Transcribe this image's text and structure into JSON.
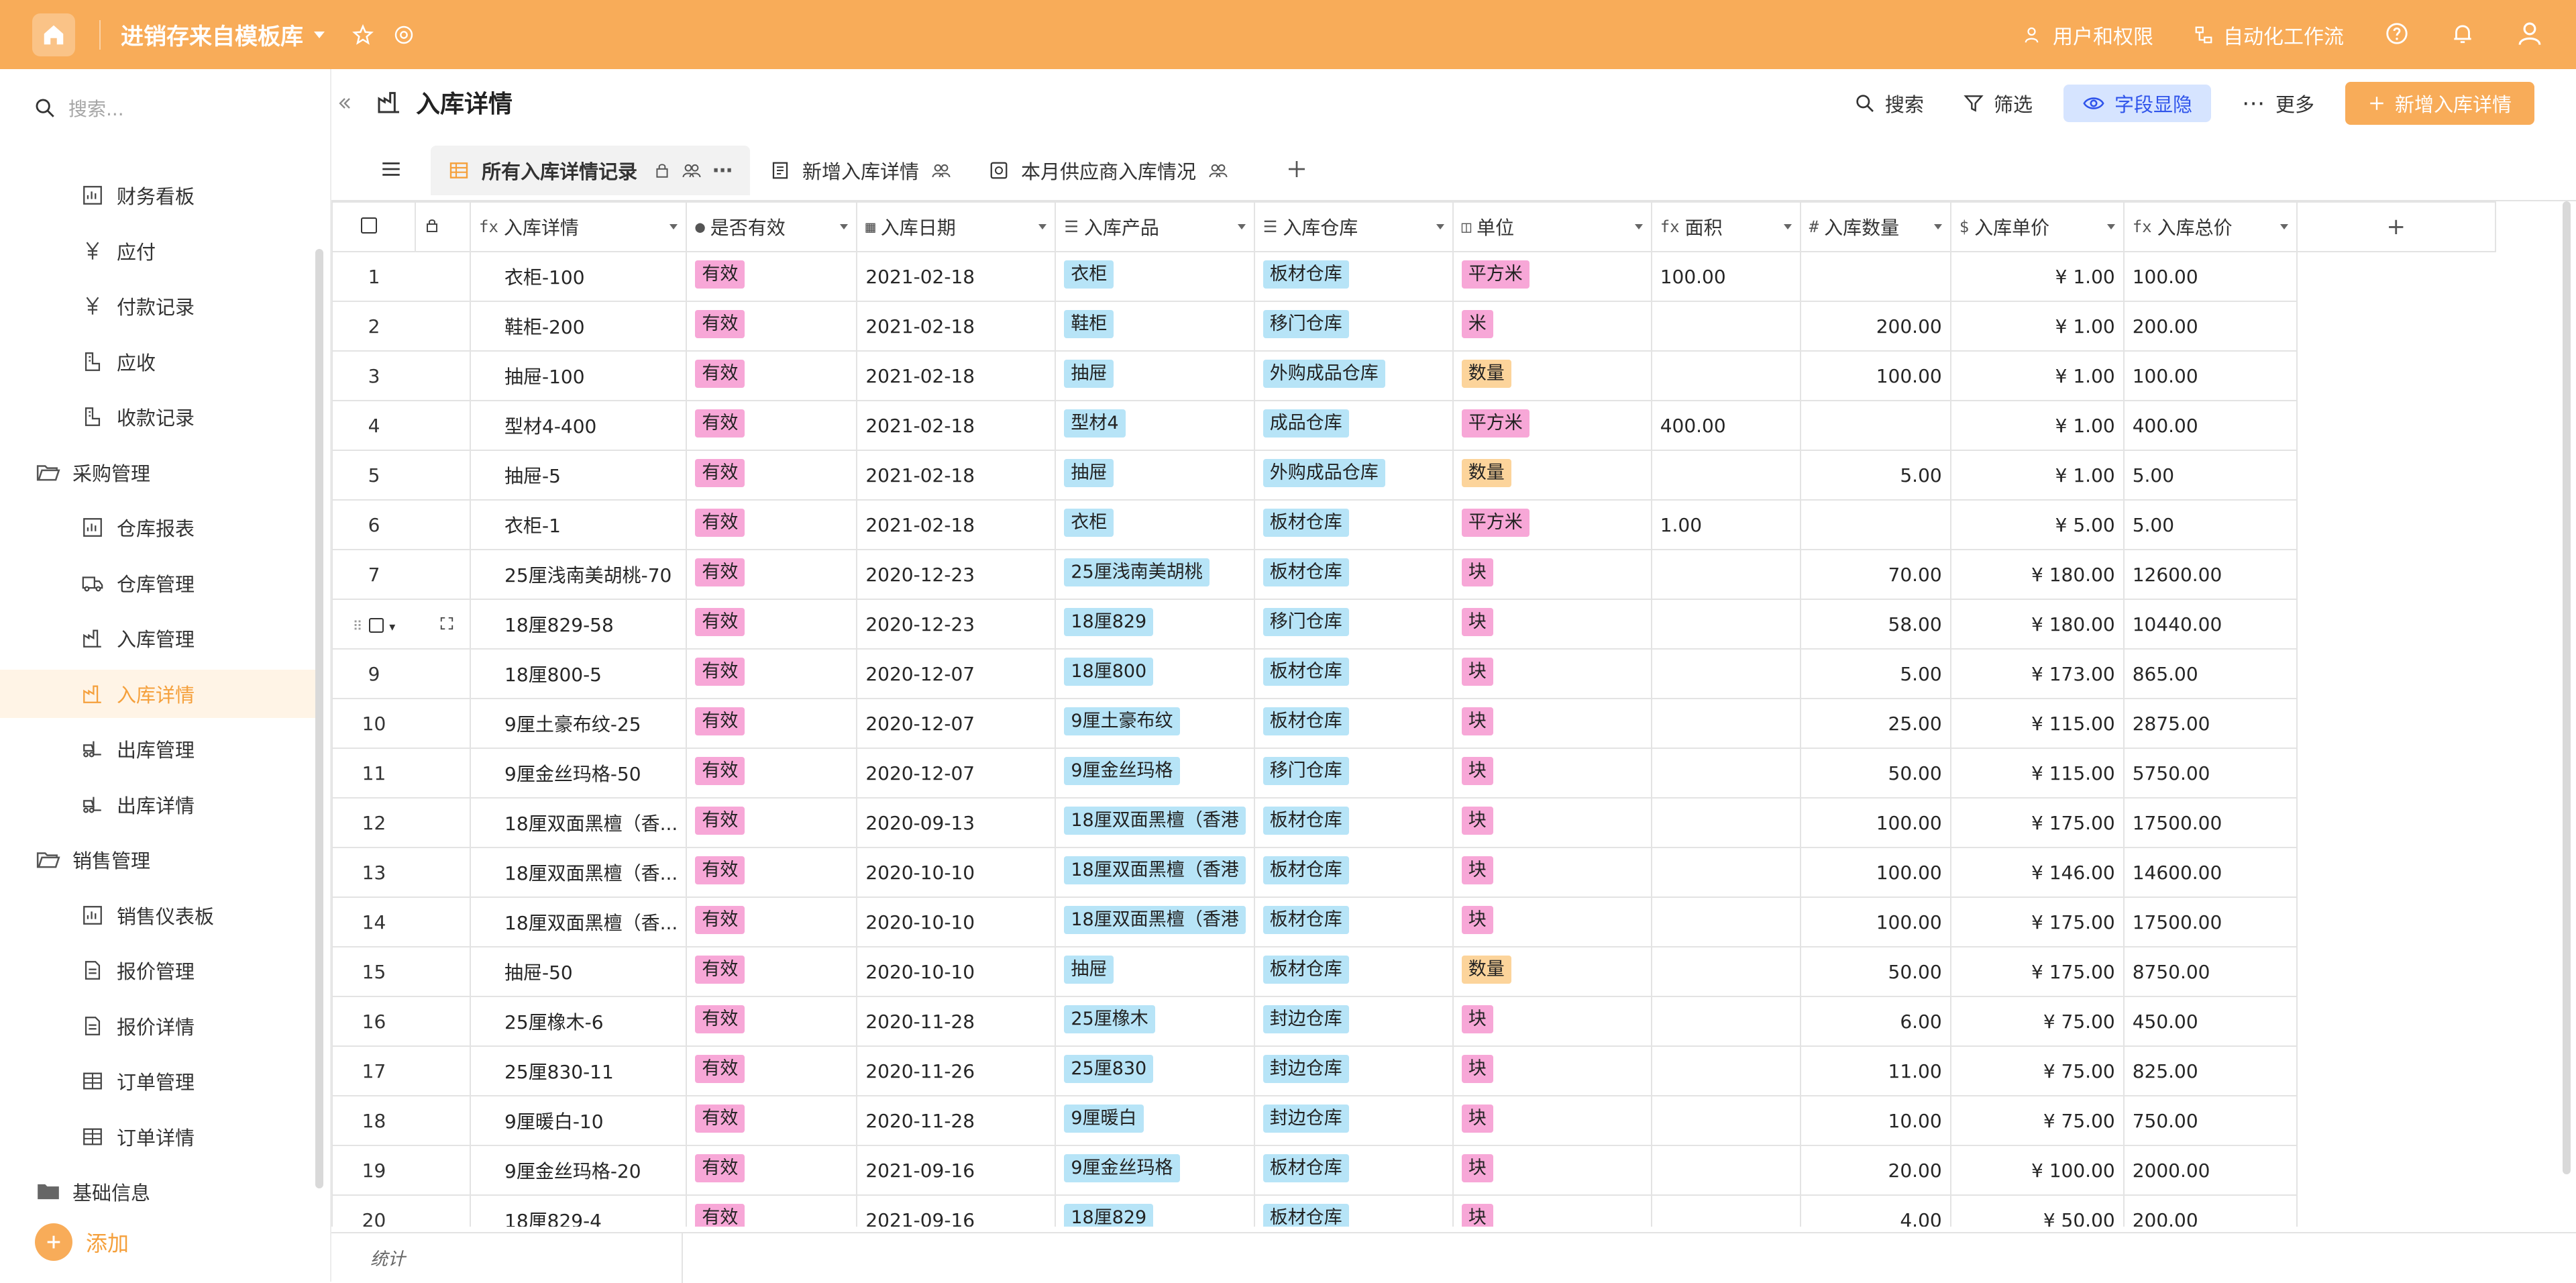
{
  "topbar": {
    "app_title": "进销存来自模板库",
    "users_label": "用户和权限",
    "automation_label": "自动化工作流"
  },
  "sidebar": {
    "search_placeholder": "搜索...",
    "items": [
      {
        "label": "财务看板",
        "level": "child",
        "icon": "dashboard-icon"
      },
      {
        "label": "应付",
        "level": "child",
        "icon": "yen-icon"
      },
      {
        "label": "付款记录",
        "level": "child",
        "icon": "yen-icon"
      },
      {
        "label": "应收",
        "level": "child",
        "icon": "receipt-icon"
      },
      {
        "label": "收款记录",
        "level": "child",
        "icon": "receipt-icon"
      },
      {
        "label": "采购管理",
        "level": "group",
        "icon": "folder-open-icon"
      },
      {
        "label": "仓库报表",
        "level": "child",
        "icon": "dashboard-icon"
      },
      {
        "label": "仓库管理",
        "level": "child",
        "icon": "truck-icon"
      },
      {
        "label": "入库管理",
        "level": "child",
        "icon": "factory-icon"
      },
      {
        "label": "入库详情",
        "level": "child",
        "icon": "factory-icon",
        "active": true
      },
      {
        "label": "出库管理",
        "level": "child",
        "icon": "forklift-icon"
      },
      {
        "label": "出库详情",
        "level": "child",
        "icon": "forklift-icon"
      },
      {
        "label": "销售管理",
        "level": "group",
        "icon": "folder-open-icon"
      },
      {
        "label": "销售仪表板",
        "level": "child",
        "icon": "dashboard-icon"
      },
      {
        "label": "报价管理",
        "level": "child",
        "icon": "document-icon"
      },
      {
        "label": "报价详情",
        "level": "child",
        "icon": "document-icon"
      },
      {
        "label": "订单管理",
        "level": "child",
        "icon": "grid-icon"
      },
      {
        "label": "订单详情",
        "level": "child",
        "icon": "grid-icon"
      },
      {
        "label": "基础信息",
        "level": "group",
        "icon": "folder-icon"
      }
    ],
    "add_label": "添加"
  },
  "header": {
    "title": "入库详情",
    "search_label": "搜索",
    "filter_label": "筛选",
    "fields_label": "字段显隐",
    "more_label": "更多",
    "new_label": "新增入库详情"
  },
  "views": {
    "tabs": [
      {
        "label": "所有入库详情记录",
        "active": true,
        "icon": "grid-view-icon"
      },
      {
        "label": "新增入库详情",
        "active": false,
        "icon": "form-view-icon"
      },
      {
        "label": "本月供应商入库情况",
        "active": false,
        "icon": "dashboard-view-icon"
      }
    ]
  },
  "table": {
    "columns": [
      {
        "label": "入库详情",
        "icon": "fx"
      },
      {
        "label": "是否有效",
        "icon": "●"
      },
      {
        "label": "入库日期",
        "icon": "▦"
      },
      {
        "label": "入库产品",
        "icon": "☰"
      },
      {
        "label": "入库仓库",
        "icon": "☰"
      },
      {
        "label": "单位",
        "icon": "◫"
      },
      {
        "label": "面积",
        "icon": "fx"
      },
      {
        "label": "入库数量",
        "icon": "#"
      },
      {
        "label": "入库单价",
        "icon": "$"
      },
      {
        "label": "入库总价",
        "icon": "fx"
      }
    ],
    "rows": [
      {
        "n": "1",
        "name": "衣柜-100",
        "valid": "有效",
        "date": "2021-02-18",
        "product": "衣柜",
        "warehouse": "板材仓库",
        "unit": "平方米",
        "unit_color": "pink",
        "area": "100.00",
        "qty": "",
        "price": "¥ 1.00",
        "total": "100.00"
      },
      {
        "n": "2",
        "name": "鞋柜-200",
        "valid": "有效",
        "date": "2021-02-18",
        "product": "鞋柜",
        "warehouse": "移门仓库",
        "unit": "米",
        "unit_color": "pink",
        "area": "",
        "qty": "200.00",
        "price": "¥ 1.00",
        "total": "200.00"
      },
      {
        "n": "3",
        "name": "抽屉-100",
        "valid": "有效",
        "date": "2021-02-18",
        "product": "抽屉",
        "warehouse": "外购成品仓库",
        "unit": "数量",
        "unit_color": "orange",
        "area": "",
        "qty": "100.00",
        "price": "¥ 1.00",
        "total": "100.00"
      },
      {
        "n": "4",
        "name": "型材4-400",
        "valid": "有效",
        "date": "2021-02-18",
        "product": "型材4",
        "warehouse": "成品仓库",
        "unit": "平方米",
        "unit_color": "pink",
        "area": "400.00",
        "qty": "",
        "price": "¥ 1.00",
        "total": "400.00"
      },
      {
        "n": "5",
        "name": "抽屉-5",
        "valid": "有效",
        "date": "2021-02-18",
        "product": "抽屉",
        "warehouse": "外购成品仓库",
        "unit": "数量",
        "unit_color": "orange",
        "area": "",
        "qty": "5.00",
        "price": "¥ 1.00",
        "total": "5.00"
      },
      {
        "n": "6",
        "name": "衣柜-1",
        "valid": "有效",
        "date": "2021-02-18",
        "product": "衣柜",
        "warehouse": "板材仓库",
        "unit": "平方米",
        "unit_color": "pink",
        "area": "1.00",
        "qty": "",
        "price": "¥ 5.00",
        "total": "5.00"
      },
      {
        "n": "7",
        "name": "25厘浅南美胡桃-70",
        "valid": "有效",
        "date": "2020-12-23",
        "product": "25厘浅南美胡桃",
        "warehouse": "板材仓库",
        "unit": "块",
        "unit_color": "pink",
        "area": "",
        "qty": "70.00",
        "price": "¥ 180.00",
        "total": "12600.00"
      },
      {
        "n": "",
        "name": "18厘829-58",
        "valid": "有效",
        "date": "2020-12-23",
        "product": "18厘829",
        "warehouse": "移门仓库",
        "unit": "块",
        "unit_color": "pink",
        "area": "",
        "qty": "58.00",
        "price": "¥ 180.00",
        "total": "10440.00",
        "hover": true
      },
      {
        "n": "9",
        "name": "18厘800-5",
        "valid": "有效",
        "date": "2020-12-07",
        "product": "18厘800",
        "warehouse": "板材仓库",
        "unit": "块",
        "unit_color": "pink",
        "area": "",
        "qty": "5.00",
        "price": "¥ 173.00",
        "total": "865.00"
      },
      {
        "n": "10",
        "name": "9厘土豪布纹-25",
        "valid": "有效",
        "date": "2020-12-07",
        "product": "9厘土豪布纹",
        "warehouse": "板材仓库",
        "unit": "块",
        "unit_color": "pink",
        "area": "",
        "qty": "25.00",
        "price": "¥ 115.00",
        "total": "2875.00"
      },
      {
        "n": "11",
        "name": "9厘金丝玛格-50",
        "valid": "有效",
        "date": "2020-12-07",
        "product": "9厘金丝玛格",
        "warehouse": "移门仓库",
        "unit": "块",
        "unit_color": "pink",
        "area": "",
        "qty": "50.00",
        "price": "¥ 115.00",
        "total": "5750.00"
      },
      {
        "n": "12",
        "name": "18厘双面黑檀（香...",
        "valid": "有效",
        "date": "2020-09-13",
        "product": "18厘双面黑檀（香港",
        "warehouse": "板材仓库",
        "unit": "块",
        "unit_color": "pink",
        "area": "",
        "qty": "100.00",
        "price": "¥ 175.00",
        "total": "17500.00"
      },
      {
        "n": "13",
        "name": "18厘双面黑檀（香...",
        "valid": "有效",
        "date": "2020-10-10",
        "product": "18厘双面黑檀（香港",
        "warehouse": "板材仓库",
        "unit": "块",
        "unit_color": "pink",
        "area": "",
        "qty": "100.00",
        "price": "¥ 146.00",
        "total": "14600.00"
      },
      {
        "n": "14",
        "name": "18厘双面黑檀（香...",
        "valid": "有效",
        "date": "2020-10-10",
        "product": "18厘双面黑檀（香港",
        "warehouse": "板材仓库",
        "unit": "块",
        "unit_color": "pink",
        "area": "",
        "qty": "100.00",
        "price": "¥ 175.00",
        "total": "17500.00"
      },
      {
        "n": "15",
        "name": "抽屉-50",
        "valid": "有效",
        "date": "2020-10-10",
        "product": "抽屉",
        "warehouse": "板材仓库",
        "unit": "数量",
        "unit_color": "orange",
        "area": "",
        "qty": "50.00",
        "price": "¥ 175.00",
        "total": "8750.00"
      },
      {
        "n": "16",
        "name": "25厘橡木-6",
        "valid": "有效",
        "date": "2020-11-28",
        "product": "25厘橡木",
        "warehouse": "封边仓库",
        "unit": "块",
        "unit_color": "pink",
        "area": "",
        "qty": "6.00",
        "price": "¥ 75.00",
        "total": "450.00"
      },
      {
        "n": "17",
        "name": "25厘830-11",
        "valid": "有效",
        "date": "2020-11-26",
        "product": "25厘830",
        "warehouse": "封边仓库",
        "unit": "块",
        "unit_color": "pink",
        "area": "",
        "qty": "11.00",
        "price": "¥ 75.00",
        "total": "825.00"
      },
      {
        "n": "18",
        "name": "9厘暖白-10",
        "valid": "有效",
        "date": "2020-11-28",
        "product": "9厘暖白",
        "warehouse": "封边仓库",
        "unit": "块",
        "unit_color": "pink",
        "area": "",
        "qty": "10.00",
        "price": "¥ 75.00",
        "total": "750.00"
      },
      {
        "n": "19",
        "name": "9厘金丝玛格-20",
        "valid": "有效",
        "date": "2021-09-16",
        "product": "9厘金丝玛格",
        "warehouse": "板材仓库",
        "unit": "块",
        "unit_color": "pink",
        "area": "",
        "qty": "20.00",
        "price": "¥ 100.00",
        "total": "2000.00"
      },
      {
        "n": "20",
        "name": "18厘829-4",
        "valid": "有效",
        "date": "2021-09-16",
        "product": "18厘829",
        "warehouse": "板材仓库",
        "unit": "块",
        "unit_color": "pink",
        "area": "",
        "qty": "4.00",
        "price": "¥ 50.00",
        "total": "200.00"
      }
    ],
    "footer_label": "统计"
  },
  "colors": {
    "accent": "#f8ac59",
    "tag_pink": "#f7a7d7",
    "tag_blue": "#b7e4f7",
    "tag_orange": "#fcd49b"
  }
}
